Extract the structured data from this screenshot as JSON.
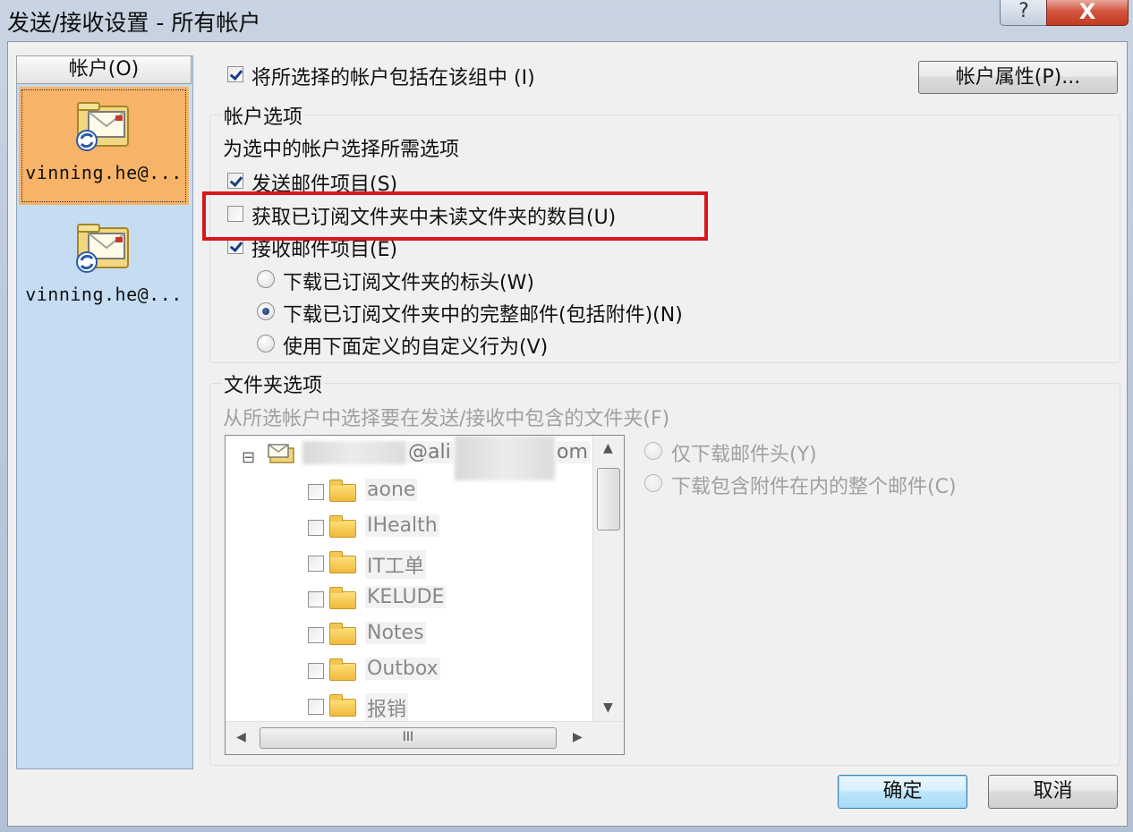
{
  "window": {
    "title": "发送/接收设置 - 所有帐户",
    "help_label": "?",
    "close_label": "X"
  },
  "accounts": {
    "header": "帐户(O)",
    "items": [
      {
        "label": "vinning.he@...",
        "selected": true
      },
      {
        "label": "vinning.he@...",
        "selected": false
      }
    ]
  },
  "include_in_group": {
    "label": "将所选择的帐户包括在该组中 (I)",
    "checked": true
  },
  "account_properties_button": "帐户属性(P)...",
  "account_options": {
    "title": "帐户选项",
    "description": "为选中的帐户选择所需选项",
    "send_items": {
      "label": "发送邮件项目(S)",
      "checked": true
    },
    "unread_count": {
      "label": "获取已订阅文件夹中未读文件夹的数目(U)",
      "checked": false
    },
    "receive_items": {
      "label": "接收邮件项目(E)",
      "checked": true
    },
    "radios": [
      {
        "label": "下载已订阅文件夹的标头(W)",
        "selected": false
      },
      {
        "label": "下载已订阅文件夹中的完整邮件(包括附件)(N)",
        "selected": true
      },
      {
        "label": "使用下面定义的自定义行为(V)",
        "selected": false
      }
    ]
  },
  "folder_options": {
    "title": "文件夹选项",
    "description": "从所选帐户中选择要在发送/接收中包含的文件夹(F)",
    "root": {
      "label_visible_part": "@ali",
      "label_tail": "om",
      "expander": "⊟"
    },
    "folders": [
      "aone",
      "IHealth",
      "IT工单",
      "KELUDE",
      "Notes",
      "Outbox",
      "报销"
    ],
    "download_radios": [
      {
        "label": "仅下载邮件头(Y)"
      },
      {
        "label": "下载包含附件在内的整个邮件(C)"
      }
    ],
    "hscroll_grip": "III"
  },
  "footer": {
    "ok_label": "确定",
    "cancel_label": "取消"
  },
  "colors": {
    "highlight_box": "#d9161c",
    "selected_account": "#f7b367",
    "account_pane": "#c6dcf2"
  }
}
